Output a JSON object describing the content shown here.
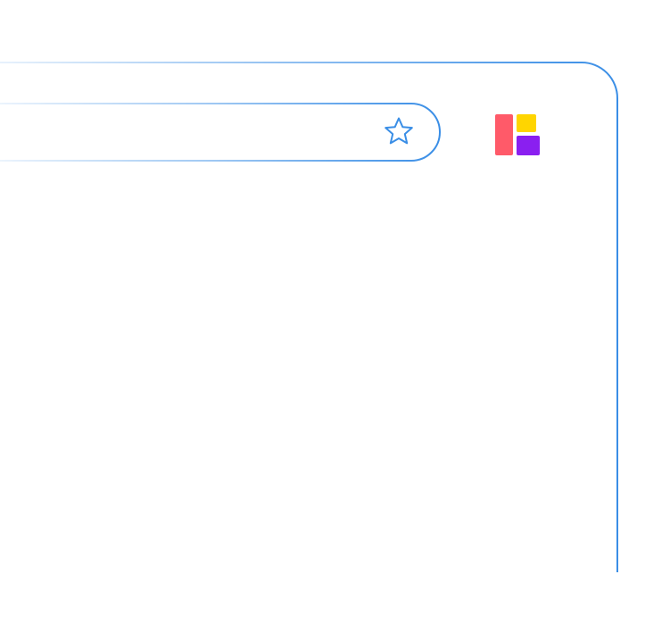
{
  "browser": {
    "address_bar": {
      "value": ""
    },
    "bookmark_star_icon": "star-outline-icon",
    "extension_logo_icon": "multicolor-blocks-logo-icon",
    "colors": {
      "frame_stroke": "#3a8ee6",
      "frame_stroke_fade": "#cfe4fb",
      "logo_red": "#ff5a69",
      "logo_yellow": "#ffd500",
      "logo_purple": "#8a1ff0"
    }
  }
}
